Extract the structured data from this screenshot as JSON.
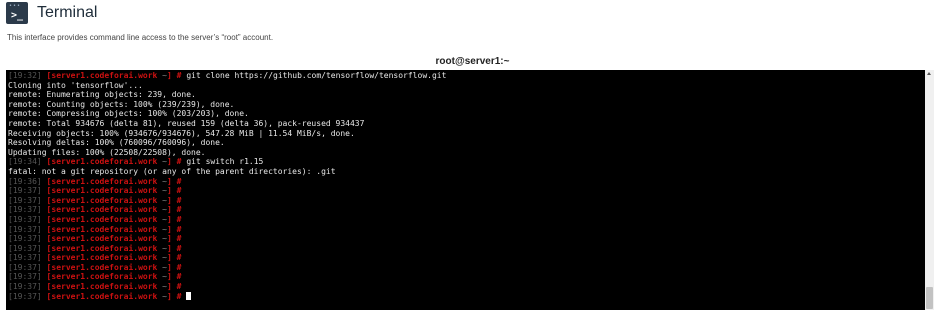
{
  "header": {
    "title": "Terminal",
    "icon": "terminal-icon",
    "description": "This interface provides command line access to the server’s “root” account."
  },
  "terminal": {
    "title": "root@server1:~",
    "colors": {
      "background": "#000000",
      "host": "#cc1111",
      "timestamp": "#555555",
      "output": "#e8e8e8"
    },
    "lines": [
      {
        "type": "prompt",
        "time": "[19:32]",
        "host": "server1.codeforai.work",
        "dir": "~",
        "cmd": "git clone https://github.com/tensorflow/tensorflow.git"
      },
      {
        "type": "output",
        "text": "Cloning into 'tensorflow'..."
      },
      {
        "type": "output",
        "text": "remote: Enumerating objects: 239, done."
      },
      {
        "type": "output",
        "text": "remote: Counting objects: 100% (239/239), done."
      },
      {
        "type": "output",
        "text": "remote: Compressing objects: 100% (203/203), done."
      },
      {
        "type": "output",
        "text": "remote: Total 934676 (delta 81), reused 159 (delta 36), pack-reused 934437"
      },
      {
        "type": "output",
        "text": "Receiving objects: 100% (934676/934676), 547.28 MiB | 11.54 MiB/s, done."
      },
      {
        "type": "output",
        "text": "Resolving deltas: 100% (760096/760096), done."
      },
      {
        "type": "output",
        "text": "Updating files: 100% (22508/22508), done."
      },
      {
        "type": "prompt",
        "time": "[19:34]",
        "host": "server1.codeforai.work",
        "dir": "~",
        "cmd": "git switch r1.15"
      },
      {
        "type": "output",
        "text": "fatal: not a git repository (or any of the parent directories): .git"
      },
      {
        "type": "prompt",
        "time": "[19:36]",
        "host": "server1.codeforai.work",
        "dir": "~",
        "cmd": ""
      },
      {
        "type": "prompt",
        "time": "[19:37]",
        "host": "server1.codeforai.work",
        "dir": "~",
        "cmd": ""
      },
      {
        "type": "prompt",
        "time": "[19:37]",
        "host": "server1.codeforai.work",
        "dir": "~",
        "cmd": ""
      },
      {
        "type": "prompt",
        "time": "[19:37]",
        "host": "server1.codeforai.work",
        "dir": "~",
        "cmd": ""
      },
      {
        "type": "prompt",
        "time": "[19:37]",
        "host": "server1.codeforai.work",
        "dir": "~",
        "cmd": ""
      },
      {
        "type": "prompt",
        "time": "[19:37]",
        "host": "server1.codeforai.work",
        "dir": "~",
        "cmd": ""
      },
      {
        "type": "prompt",
        "time": "[19:37]",
        "host": "server1.codeforai.work",
        "dir": "~",
        "cmd": ""
      },
      {
        "type": "prompt",
        "time": "[19:37]",
        "host": "server1.codeforai.work",
        "dir": "~",
        "cmd": ""
      },
      {
        "type": "prompt",
        "time": "[19:37]",
        "host": "server1.codeforai.work",
        "dir": "~",
        "cmd": ""
      },
      {
        "type": "prompt",
        "time": "[19:37]",
        "host": "server1.codeforai.work",
        "dir": "~",
        "cmd": ""
      },
      {
        "type": "prompt",
        "time": "[19:37]",
        "host": "server1.codeforai.work",
        "dir": "~",
        "cmd": ""
      },
      {
        "type": "prompt",
        "time": "[19:37]",
        "host": "server1.codeforai.work",
        "dir": "~",
        "cmd": ""
      },
      {
        "type": "prompt",
        "time": "[19:37]",
        "host": "server1.codeforai.work",
        "dir": "~",
        "cmd": "",
        "cursor": true
      }
    ]
  }
}
